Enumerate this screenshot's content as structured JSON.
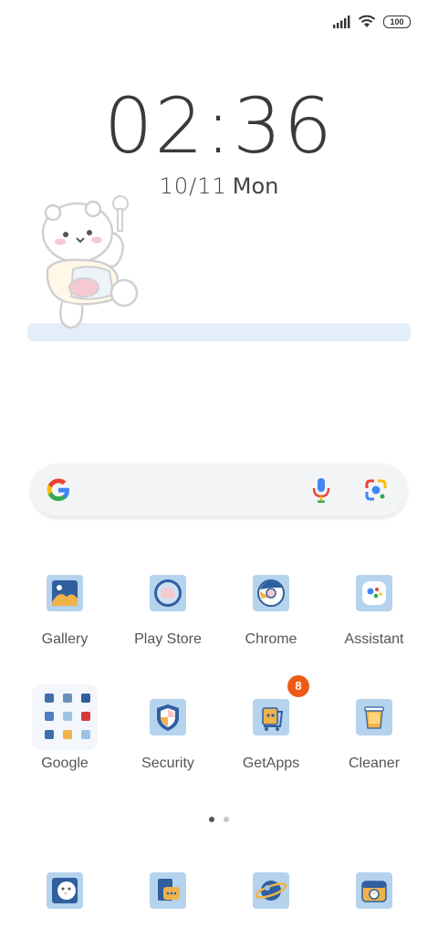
{
  "status_bar": {
    "battery_level": "100",
    "signal_icon": "cellular-signal-icon",
    "wifi_icon": "wifi-icon"
  },
  "clock": {
    "time": "02:36",
    "date": "10/11",
    "day": "Mon"
  },
  "search": {
    "google_icon": "google-logo-icon",
    "mic_icon": "microphone-icon",
    "lens_icon": "google-lens-icon"
  },
  "apps": [
    {
      "label": "Gallery",
      "icon": "gallery-icon"
    },
    {
      "label": "Play Store",
      "icon": "play-store-icon"
    },
    {
      "label": "Chrome",
      "icon": "chrome-icon"
    },
    {
      "label": "Assistant",
      "icon": "assistant-icon"
    },
    {
      "label": "Google",
      "icon": "folder-icon"
    },
    {
      "label": "Security",
      "icon": "security-icon"
    },
    {
      "label": "GetApps",
      "icon": "getapps-icon",
      "badge": "8"
    },
    {
      "label": "Cleaner",
      "icon": "cleaner-icon"
    }
  ],
  "dock": [
    {
      "icon": "phone-icon"
    },
    {
      "icon": "messages-icon"
    },
    {
      "icon": "browser-icon"
    },
    {
      "icon": "camera-icon"
    }
  ],
  "page_indicator": {
    "pages": 2,
    "active": 1
  },
  "colors": {
    "icon_bg": "#b6d3ee",
    "badge": "#ee5a16",
    "widget_shelf": "#e4eef9"
  }
}
